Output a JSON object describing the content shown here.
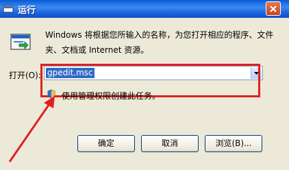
{
  "window": {
    "title": "运行",
    "close_glyph": "close-icon"
  },
  "dialog": {
    "description": "Windows 将根据您所输入的名称，为您打开相应的程序、文件夹、文档或 Internet 资源。",
    "open_label": "打开(O):",
    "command_value": "gpedit.msc",
    "admin_note": "使用管理权限创建此任务。",
    "buttons": {
      "ok": "确定",
      "cancel": "取消",
      "browse": "浏览(B)..."
    }
  },
  "annotation": {
    "color": "#e02020"
  }
}
